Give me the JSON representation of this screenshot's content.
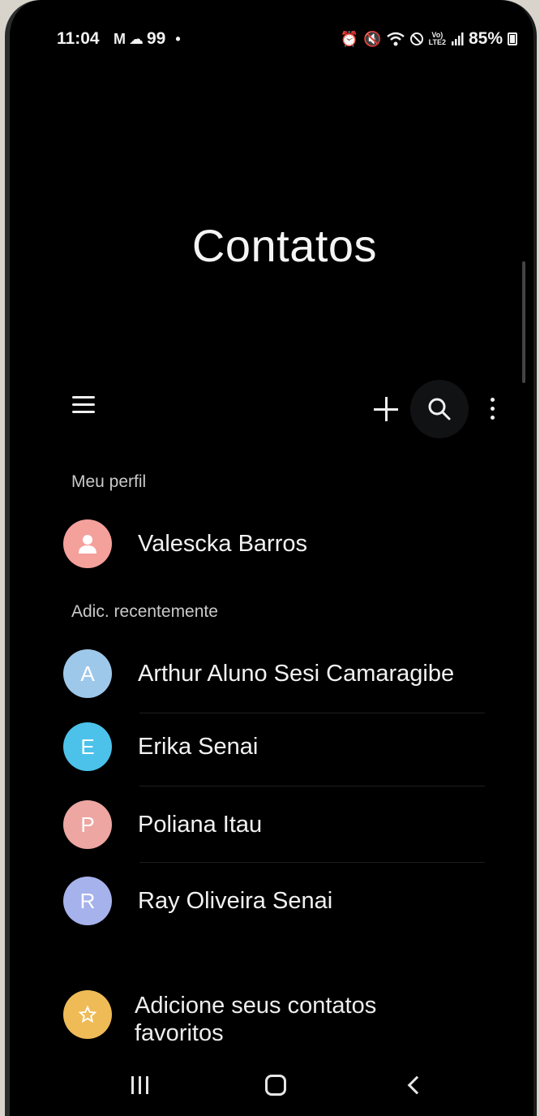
{
  "status_bar": {
    "time": "11:04",
    "left_icons": [
      "gmail-icon",
      "cloud-icon",
      "99"
    ],
    "battery": "85%",
    "right_icons": [
      "alarm-icon",
      "mute-icon",
      "wifi-icon",
      "dnd-icon",
      "volte-icon",
      "signal-icon",
      "battery-icon"
    ]
  },
  "header": {
    "title": "Contatos"
  },
  "toolbar": {
    "menu_icon": "hamburger-icon",
    "add_icon": "plus-icon",
    "search_icon": "search-icon",
    "more_icon": "more-vertical-icon"
  },
  "profile_section": {
    "label": "Meu perfil",
    "name": "Valescka Barros",
    "avatar_icon": "person-icon",
    "avatar_color": "#f4a09b"
  },
  "recent_section": {
    "label": "Adic. recentemente",
    "contacts": [
      {
        "initial": "A",
        "name": "Arthur Aluno Sesi Camaragibe",
        "color": "#9ec8ea"
      },
      {
        "initial": "E",
        "name": "Erika Senai",
        "color": "#4cc2ea"
      },
      {
        "initial": "P",
        "name": "Poliana Itau",
        "color": "#eda6a2"
      },
      {
        "initial": "R",
        "name": "Ray Oliveira Senai",
        "color": "#a6b2ec"
      }
    ]
  },
  "favorites": {
    "text": "Adicione seus contatos favoritos",
    "icon": "star-icon",
    "color": "#efbb57"
  },
  "nav_bar": {
    "recents_icon": "recents-icon",
    "home_icon": "home-icon",
    "back_icon": "back-icon"
  }
}
